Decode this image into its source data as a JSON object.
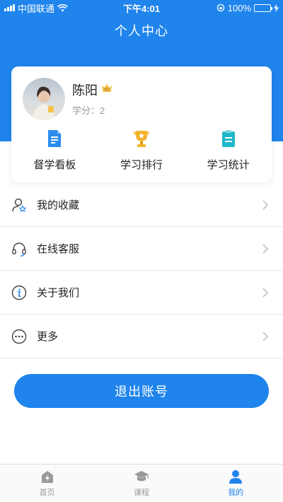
{
  "status_bar": {
    "carrier": "中国联通",
    "time": "下午4:01",
    "battery_text": "100%",
    "battery_level": 1.0
  },
  "header": {
    "title": "个人中心"
  },
  "profile": {
    "name": "陈阳",
    "vip_badge": "V1",
    "credit_label": "学分：",
    "credit_value": "2"
  },
  "quick_actions": [
    {
      "label": "督学看板",
      "icon": "dashboard-icon",
      "color": "#2b8cee"
    },
    {
      "label": "学习排行",
      "icon": "trophy-icon",
      "color": "#f2b22e"
    },
    {
      "label": "学习统计",
      "icon": "statistics-icon",
      "color": "#1fb8c8"
    }
  ],
  "menu": [
    {
      "label": "我的收藏",
      "icon": "user-star-icon"
    },
    {
      "label": "在线客服",
      "icon": "headset-icon"
    },
    {
      "label": "关于我们",
      "icon": "info-icon"
    },
    {
      "label": "更多",
      "icon": "more-icon"
    }
  ],
  "logout_label": "退出账号",
  "tabs": [
    {
      "label": "首页",
      "icon": "home-icon",
      "active": false
    },
    {
      "label": "课程",
      "icon": "graduation-cap-icon",
      "active": false
    },
    {
      "label": "我的",
      "icon": "person-icon",
      "active": true
    }
  ],
  "colors": {
    "primary": "#1f84ec",
    "inactive": "#999999"
  }
}
